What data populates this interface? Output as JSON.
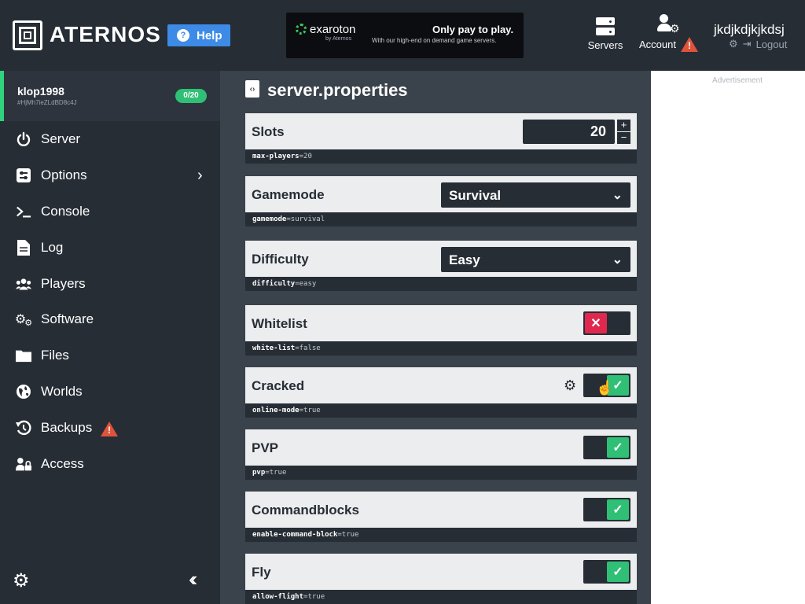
{
  "header": {
    "logo_text": "ATERNOS",
    "help_label": "Help",
    "banner": {
      "brand": "exaroton",
      "brand_by": "by Aternos",
      "title": "Only pay to play.",
      "subtitle": "With our high-end on demand game servers."
    },
    "nav": {
      "servers_label": "Servers",
      "account_label": "Account"
    },
    "user": {
      "name": "jkdjkdjkjkdsj",
      "logout_label": "Logout"
    }
  },
  "sidebar": {
    "server": {
      "name": "klop1998",
      "id": "#HjMh7ieZLdBD8c4J",
      "players": "0/20"
    },
    "items": [
      {
        "label": "Server",
        "icon": "power-icon"
      },
      {
        "label": "Options",
        "icon": "sliders-icon"
      },
      {
        "label": "Console",
        "icon": "terminal-icon"
      },
      {
        "label": "Log",
        "icon": "file-icon"
      },
      {
        "label": "Players",
        "icon": "users-icon"
      },
      {
        "label": "Software",
        "icon": "cogs-icon"
      },
      {
        "label": "Files",
        "icon": "folder-icon"
      },
      {
        "label": "Worlds",
        "icon": "globe-icon"
      },
      {
        "label": "Backups",
        "icon": "backup-icon"
      },
      {
        "label": "Access",
        "icon": "user-lock-icon"
      }
    ]
  },
  "main": {
    "page_title": "server.properties",
    "props": [
      {
        "label": "Slots",
        "key": "max-players",
        "value": "20",
        "control": "number"
      },
      {
        "label": "Gamemode",
        "key": "gamemode",
        "value": "survival",
        "control": "select",
        "selected": "Survival"
      },
      {
        "label": "Difficulty",
        "key": "difficulty",
        "value": "easy",
        "control": "select",
        "selected": "Easy"
      },
      {
        "label": "Whitelist",
        "key": "white-list",
        "value": "false",
        "control": "toggle"
      },
      {
        "label": "Cracked",
        "key": "online-mode",
        "value": "true",
        "control": "toggle"
      },
      {
        "label": "PVP",
        "key": "pvp",
        "value": "true",
        "control": "toggle"
      },
      {
        "label": "Commandblocks",
        "key": "enable-command-block",
        "value": "true",
        "control": "toggle"
      },
      {
        "label": "Fly",
        "key": "allow-flight",
        "value": "true",
        "control": "toggle"
      }
    ]
  },
  "ads": {
    "label": "Advertisement"
  },
  "colors": {
    "accent_green": "#2fbf75",
    "toggle_off_red": "#e0284f",
    "help_blue": "#3d8be6",
    "warning_orange": "#e0533a"
  }
}
